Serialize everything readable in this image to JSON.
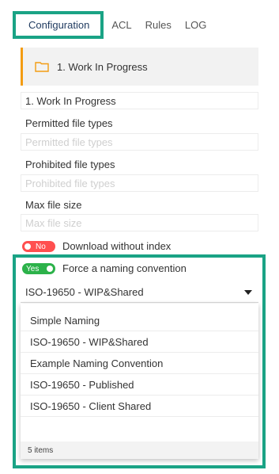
{
  "tabs": [
    {
      "label": "Configuration"
    },
    {
      "label": "ACL"
    },
    {
      "label": "Rules"
    },
    {
      "label": "LOG"
    }
  ],
  "folder": {
    "title": "1. Work In Progress",
    "icon": "folder-icon",
    "accent": "#f39c12"
  },
  "fields": {
    "name_value": "1. Work In Progress",
    "permitted_label": "Permitted file types",
    "permitted_placeholder": "Permitted file types",
    "prohibited_label": "Prohibited file types",
    "prohibited_placeholder": "Prohibited file types",
    "max_size_label": "Max file size",
    "max_size_placeholder": "Max file size"
  },
  "toggles": {
    "download_state": "No",
    "download_label": "Download without index",
    "naming_state": "Yes",
    "naming_label": "Force a naming convention"
  },
  "naming_select": {
    "selected": "ISO-19650 - WIP&Shared",
    "options": [
      "Simple Naming",
      "ISO-19650 - WIP&Shared",
      "Example Naming Convention",
      "ISO-19650 - Published",
      "ISO-19650 - Client Shared"
    ],
    "count_label": "5 items"
  },
  "colors": {
    "highlight": "#1aa385",
    "toggle_off": "#ff4f4f",
    "toggle_on": "#2cb24a"
  }
}
